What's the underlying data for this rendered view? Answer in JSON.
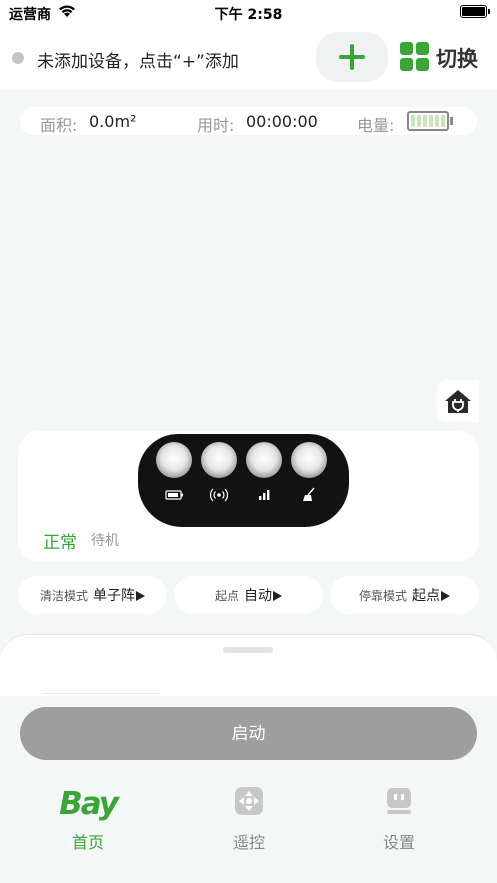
{
  "status_bar": {
    "carrier": "运营商",
    "time": "下午 2:58"
  },
  "header": {
    "device_status": "未添加设备，点击“+”添加",
    "switch_label": "切换"
  },
  "stats": {
    "area_label": "面积:",
    "area_value": "0.0m²",
    "time_label": "用时:",
    "time_value": "00:00:00",
    "battery_label": "电量:"
  },
  "robot": {
    "state": "正常",
    "mode_state": "待机"
  },
  "modes": [
    {
      "label": "清洁模式",
      "value": "单子阵"
    },
    {
      "label": "起点",
      "value": "自动"
    },
    {
      "label": "停靠模式",
      "value": "起点"
    }
  ],
  "start_label": "启动",
  "tabs": [
    {
      "label": "首页",
      "logo": "Bay",
      "active": true,
      "icon": "bay-logo-icon"
    },
    {
      "label": "遥控",
      "active": false,
      "icon": "remote-dpad-icon"
    },
    {
      "label": "设置",
      "active": false,
      "icon": "robot-settings-icon"
    }
  ],
  "colors": {
    "accent": "#39a537",
    "background": "#f3f8f6",
    "button_disabled": "#9e9e9e"
  }
}
